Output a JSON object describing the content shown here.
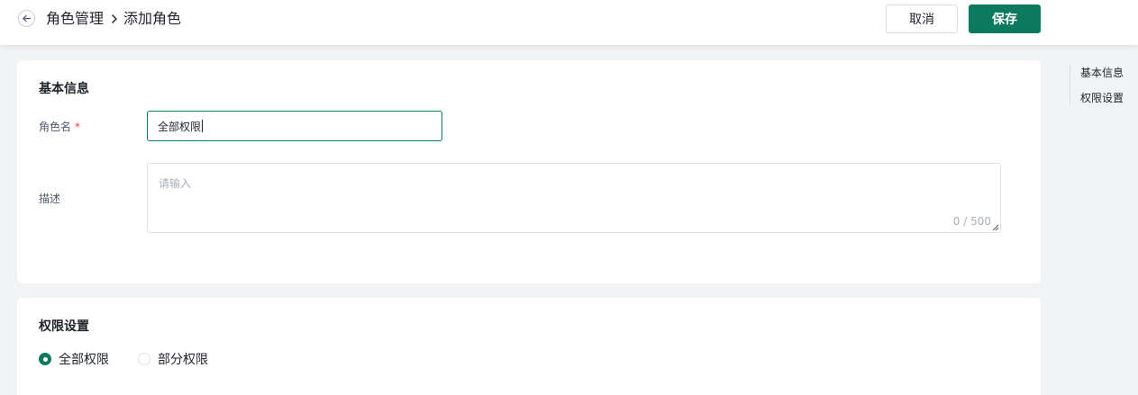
{
  "header": {
    "breadcrumb": [
      "角色管理",
      "添加角色"
    ],
    "cancel_label": "取消",
    "save_label": "保存"
  },
  "basic_info": {
    "title": "基本信息",
    "role_name": {
      "label": "角色名",
      "required_mark": "*",
      "value": "全部权限"
    },
    "description": {
      "label": "描述",
      "placeholder": "请输入",
      "counter": "0 / 500"
    }
  },
  "permissions": {
    "title": "权限设置",
    "options": [
      {
        "label": "全部权限",
        "selected": true
      },
      {
        "label": "部分权限",
        "selected": false
      }
    ]
  },
  "anchor_nav": [
    "基本信息",
    "权限设置"
  ],
  "colors": {
    "primary": "#0d7a5f",
    "required": "#f53f3f",
    "background": "#f2f3f5"
  }
}
